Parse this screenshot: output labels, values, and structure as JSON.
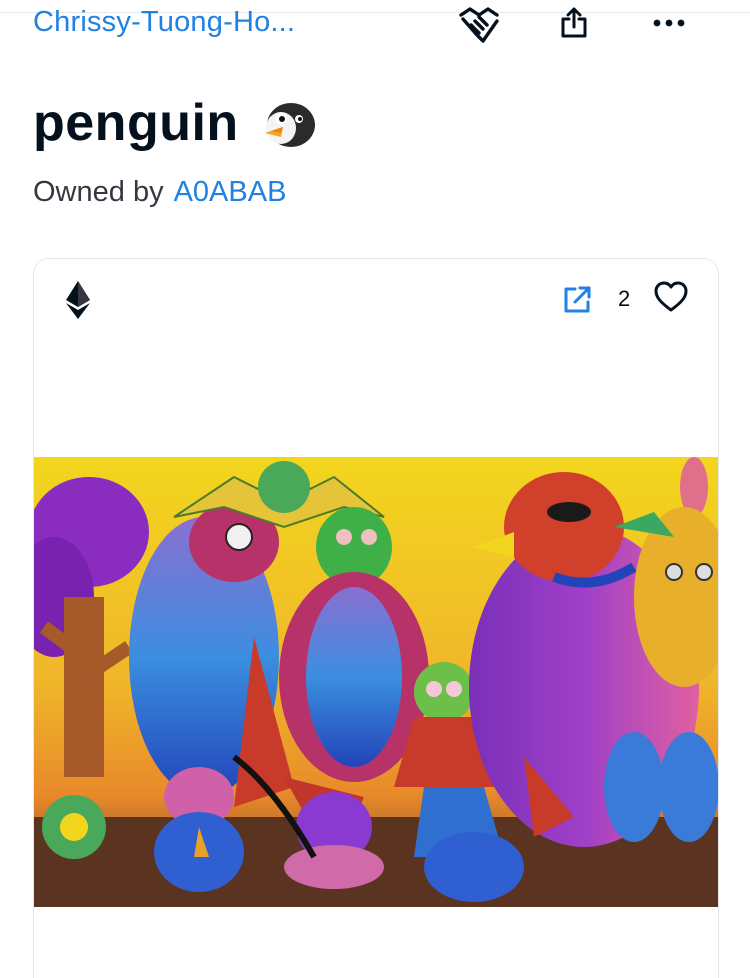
{
  "header": {
    "collection_name": "Chrissy-Tuong-Ho...",
    "actions": [
      {
        "name": "make-offer",
        "icon": "handshake-icon"
      },
      {
        "name": "share",
        "icon": "share-icon"
      },
      {
        "name": "more",
        "icon": "more-horizontal-icon"
      }
    ]
  },
  "item": {
    "title": "penguin",
    "title_emoji": "penguin-icon",
    "owner_prefix": "Owned by",
    "owner_name": "A0ABAB"
  },
  "card": {
    "chain_icon": "ethereum-icon",
    "external_link_icon": "external-link-icon",
    "favorites_count": "2",
    "favorite_icon": "heart-icon",
    "image": "childrens-crayon-drawing-of-birds-and-animals"
  },
  "colors": {
    "link": "#2081e2",
    "text": "#04111d",
    "border": "#e5e8eb"
  }
}
